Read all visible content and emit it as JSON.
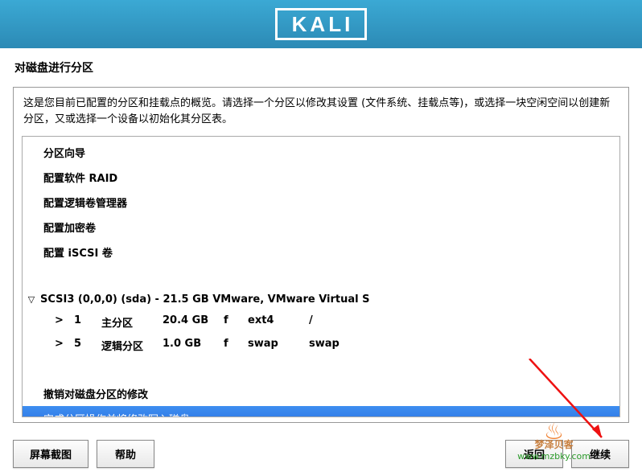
{
  "header": {
    "logo_text": "KALI"
  },
  "title": "对磁盘进行分区",
  "description": "这是您目前已配置的分区和挂载点的概览。请选择一个分区以修改其设置 (文件系统、挂载点等)，或选择一块空闲空间以创建新分区，又或选择一个设备以初始化其分区表。",
  "menu": {
    "guided": "分区向导",
    "raid": "配置软件 RAID",
    "lvm": "配置逻辑卷管理器",
    "encrypted": "配置加密卷",
    "iscsi": "配置 iSCSI 卷"
  },
  "disk": {
    "label": "SCSI3 (0,0,0) (sda) - 21.5 GB VMware, VMware Virtual S",
    "partitions": [
      {
        "arrow": ">",
        "num": "1",
        "type": "主分区",
        "size": "20.4 GB",
        "flag": "f",
        "fs": "ext4",
        "mnt": "/"
      },
      {
        "arrow": ">",
        "num": "5",
        "type": "逻辑分区",
        "size": "1.0 GB",
        "flag": "f",
        "fs": "swap",
        "mnt": "swap"
      }
    ]
  },
  "undo": "撤销对磁盘分区的修改",
  "finish": "完成分区操作并将修改写入磁盘",
  "buttons": {
    "screenshot": "屏幕截图",
    "help": "帮助",
    "back": "返回",
    "continue": "继续"
  },
  "watermark": {
    "name": "梦泽贝客",
    "url": "www.mzbky.com"
  }
}
